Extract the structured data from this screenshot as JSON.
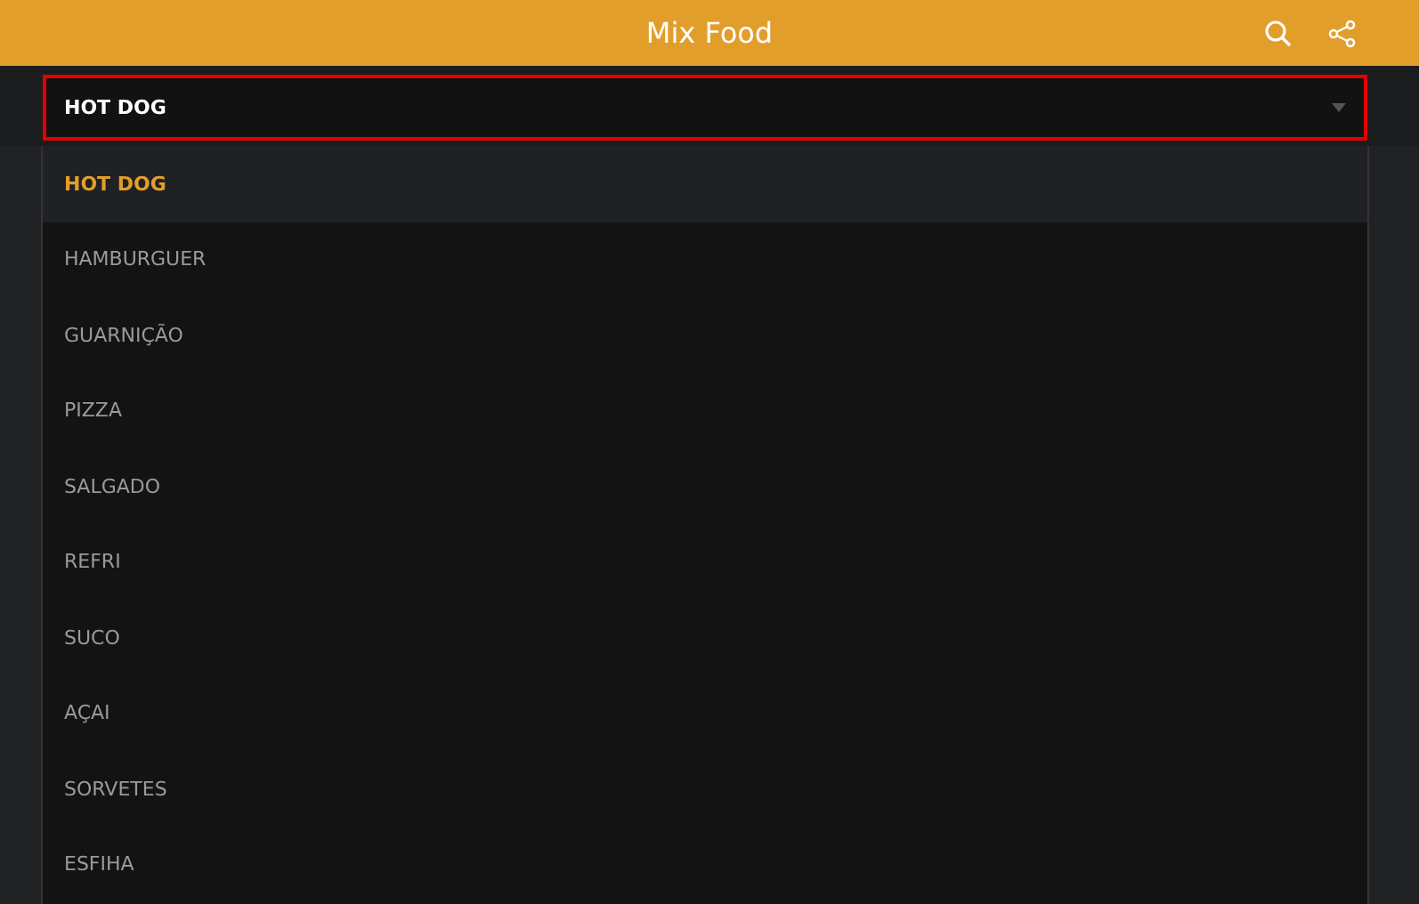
{
  "app_bar": {
    "title": "Mix Food"
  },
  "category_select": {
    "value": "HOT DOG",
    "expanded": true
  },
  "options": [
    {
      "label": "HOT DOG",
      "selected": true
    },
    {
      "label": "HAMBURGUER",
      "selected": false
    },
    {
      "label": "GUARNIÇÃO",
      "selected": false
    },
    {
      "label": "PIZZA",
      "selected": false
    },
    {
      "label": "SALGADO",
      "selected": false
    },
    {
      "label": "REFRI",
      "selected": false
    },
    {
      "label": "SUCO",
      "selected": false
    },
    {
      "label": "AÇAI",
      "selected": false
    },
    {
      "label": "SORVETES",
      "selected": false
    },
    {
      "label": "ESFIHA",
      "selected": false
    }
  ]
}
